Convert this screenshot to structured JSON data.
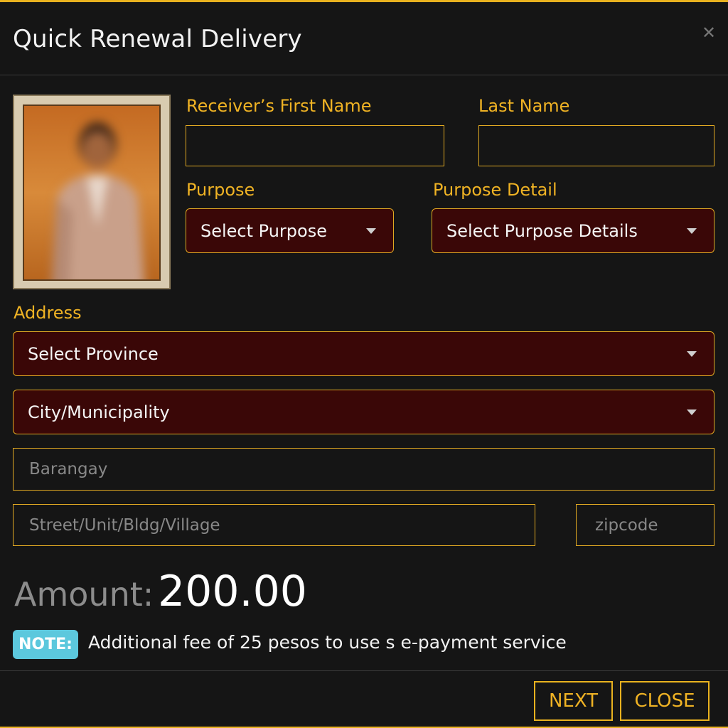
{
  "modal": {
    "title": "Quick Renewal Delivery",
    "close_icon": "close-icon"
  },
  "form": {
    "first_name_label": "Receiver’s First Name",
    "first_name_value": "",
    "last_name_label": "Last Name",
    "last_name_value": "",
    "purpose_label": "Purpose",
    "purpose_selected": "Select Purpose",
    "purpose_detail_label": "Purpose Detail",
    "purpose_detail_selected": "Select Purpose Details",
    "address_label": "Address",
    "province_selected": "Select Province",
    "city_selected": "City/Municipality",
    "barangay_placeholder": "Barangay",
    "street_placeholder": "Street/Unit/Bldg/Village",
    "zipcode_placeholder": "zipcode"
  },
  "amount": {
    "label": "Amount:",
    "value": "200.00"
  },
  "note": {
    "badge": "NOTE:",
    "text": "Additional fee of 25 pesos to use s e-payment service"
  },
  "buttons": {
    "next": "NEXT",
    "close": "CLOSE"
  },
  "colors": {
    "accent": "#e9b21f",
    "select_bg": "#3a0707",
    "background": "#151515",
    "note_badge": "#5cc8dd"
  }
}
